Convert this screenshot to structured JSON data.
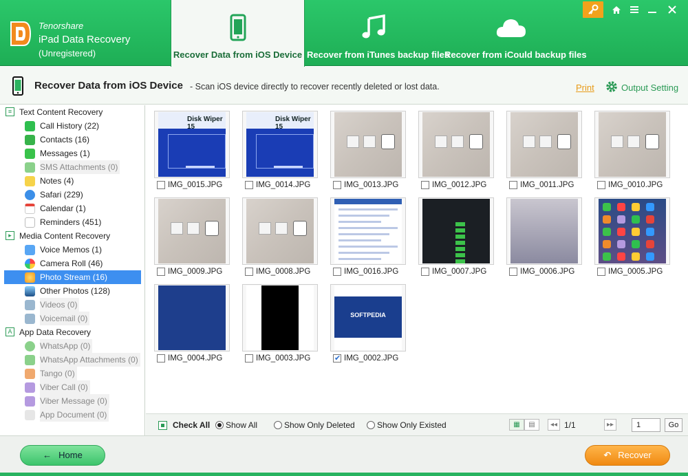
{
  "brand": {
    "company": "Tenorshare",
    "product": "iPad Data Recovery",
    "registration": "(Unregistered)"
  },
  "modes": [
    {
      "label": "Recover Data from iOS Device",
      "icon": "phone-icon"
    },
    {
      "label": "Recover from iTunes backup files",
      "icon": "music-note-icon"
    },
    {
      "label": "Recover from iCould backup files",
      "icon": "cloud-icon"
    }
  ],
  "subheader": {
    "title": "Recover Data from iOS Device",
    "description": "- Scan iOS device directly to recover recently deleted or lost data.",
    "print": "Print",
    "output_setting": "Output Setting"
  },
  "sidebar": {
    "categories": [
      {
        "label": "Text Content Recovery",
        "icon": "list-icon"
      },
      {
        "label": "Media Content Recovery",
        "icon": "play-icon"
      },
      {
        "label": "App Data Recovery",
        "icon": "app-icon"
      }
    ],
    "items": [
      {
        "label": "Call History (22)",
        "icon": "phone-call-icon",
        "color": "#2fbf4f"
      },
      {
        "label": "Contacts (16)",
        "icon": "contacts-icon",
        "color": "#37b34a"
      },
      {
        "label": "Messages (1)",
        "icon": "message-icon",
        "color": "#39c24a"
      },
      {
        "label": "SMS Attachments (0)",
        "icon": "attachment-icon",
        "color": "#8bd18b"
      },
      {
        "label": "Notes (4)",
        "icon": "notes-icon",
        "color": "#f6d34a"
      },
      {
        "label": "Safari (229)",
        "icon": "compass-icon",
        "color": "#3c8fe8"
      },
      {
        "label": "Calendar (1)",
        "icon": "calendar-icon",
        "color": "#e6443a"
      },
      {
        "label": "Reminders (451)",
        "icon": "reminders-icon",
        "color": "#9aa3b0"
      },
      {
        "label": "Voice Memos (1)",
        "icon": "microphone-icon",
        "color": "#58a6f4"
      },
      {
        "label": "Camera Roll (46)",
        "icon": "camera-roll-icon",
        "color": "#f08b2b"
      },
      {
        "label": "Photo Stream (16)",
        "icon": "photo-stream-icon",
        "color": "#f6b43a"
      },
      {
        "label": "Other Photos (128)",
        "icon": "photos-icon",
        "color": "#2b6aa8"
      },
      {
        "label": "Videos (0)",
        "icon": "video-icon",
        "color": "#9ab7cf"
      },
      {
        "label": "Voicemail (0)",
        "icon": "voicemail-icon",
        "color": "#9ab7cf"
      },
      {
        "label": "WhatsApp (0)",
        "icon": "whatsapp-icon",
        "color": "#8bd18b"
      },
      {
        "label": "WhatsApp Attachments (0)",
        "icon": "attachment-icon",
        "color": "#8bd18b"
      },
      {
        "label": "Tango (0)",
        "icon": "tango-icon",
        "color": "#f0a96e"
      },
      {
        "label": "Viber Call (0)",
        "icon": "viber-icon",
        "color": "#b59ae0"
      },
      {
        "label": "Viber Message (0)",
        "icon": "viber-message-icon",
        "color": "#b59ae0"
      },
      {
        "label": "App Document (0)",
        "icon": "document-icon",
        "color": "#cfcfcf"
      }
    ],
    "selected": "Photo Stream (16)"
  },
  "photos": [
    {
      "name": "IMG_0015.JPG",
      "checked": false,
      "kind": "disk"
    },
    {
      "name": "IMG_0014.JPG",
      "checked": false,
      "kind": "disk"
    },
    {
      "name": "IMG_0013.JPG",
      "checked": false,
      "kind": "wall"
    },
    {
      "name": "IMG_0012.JPG",
      "checked": false,
      "kind": "wall"
    },
    {
      "name": "IMG_0011.JPG",
      "checked": false,
      "kind": "wall"
    },
    {
      "name": "IMG_0010.JPG",
      "checked": false,
      "kind": "wall"
    },
    {
      "name": "IMG_0009.JPG",
      "checked": false,
      "kind": "wall"
    },
    {
      "name": "IMG_0008.JPG",
      "checked": false,
      "kind": "wall"
    },
    {
      "name": "IMG_0016.JPG",
      "checked": false,
      "kind": "web"
    },
    {
      "name": "IMG_0007.JPG",
      "checked": false,
      "kind": "dark"
    },
    {
      "name": "IMG_0006.JPG",
      "checked": false,
      "kind": "cc"
    },
    {
      "name": "IMG_0005.JPG",
      "checked": false,
      "kind": "home"
    },
    {
      "name": "IMG_0004.JPG",
      "checked": false,
      "kind": "blue"
    },
    {
      "name": "IMG_0003.JPG",
      "checked": false,
      "kind": "black"
    },
    {
      "name": "IMG_0002.JPG",
      "checked": true,
      "kind": "soft"
    }
  ],
  "thumb_text": {
    "disk_title": "Disk Wiper 15",
    "softpedia": "SOFTPEDIA"
  },
  "toolbar": {
    "check_all": "Check All",
    "show_all": "Show All",
    "show_deleted": "Show Only Deleted",
    "show_existed": "Show Only Existed",
    "page_indicator": "1/1",
    "page_input": "1",
    "go": "Go"
  },
  "footer": {
    "home": "Home",
    "recover": "Recover"
  },
  "colors": {
    "brand_green": "#1eae55",
    "accent_orange": "#f08a12",
    "selection_blue": "#3d8ff0"
  }
}
